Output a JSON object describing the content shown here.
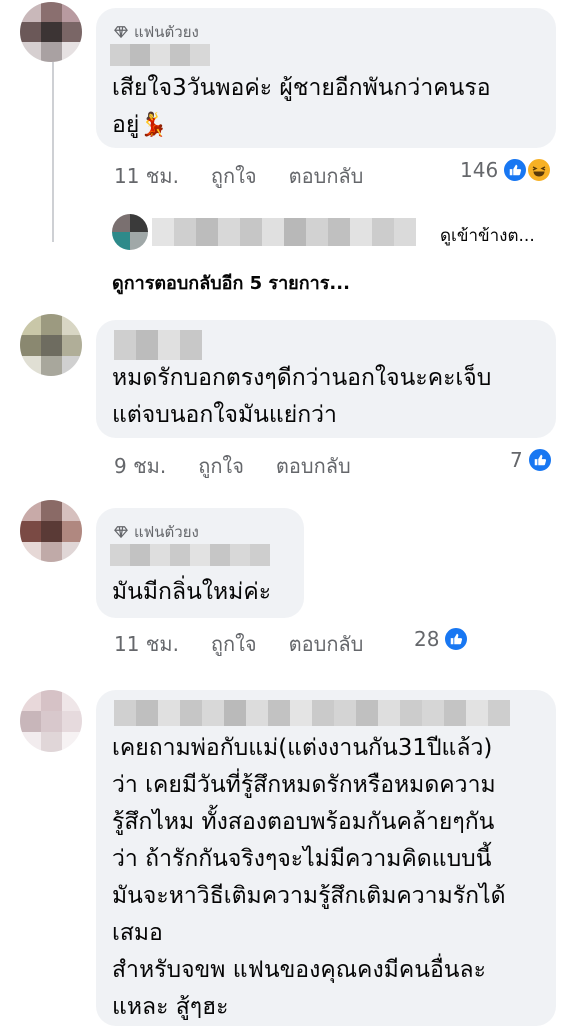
{
  "comments": [
    {
      "badge": "แฟนตัวยง",
      "text": "เสียใจ3วันพอค่ะ ผู้ชายอีกพันกว่าคนรอ\nอยู่💃",
      "time": "11 ชม.",
      "like_label": "ถูกใจ",
      "reply_label": "ตอบกลับ",
      "reaction_count": "146",
      "reactions": [
        "like-icon",
        "haha-icon"
      ]
    },
    {
      "badge": "",
      "text": "หมดรักบอกตรงๆดีกว่านอกใจนะคะเจ็บ\nแต่จบนอกใจมันแย่กว่า",
      "time": "9 ชม.",
      "like_label": "ถูกใจ",
      "reply_label": "ตอบกลับ",
      "reaction_count": "7",
      "reactions": [
        "like-icon"
      ]
    },
    {
      "badge": "แฟนตัวยง",
      "text": "มันมีกลิ่นใหม่ค่ะ",
      "time": "11 ชม.",
      "like_label": "ถูกใจ",
      "reply_label": "ตอบกลับ",
      "reaction_count": "28",
      "reactions": [
        "like-icon"
      ]
    },
    {
      "badge": "",
      "text": "เคยถามพ่อกับแม่(แต่งงานกัน31ปีแล้ว)\nว่า เคยมีวันที่รู้สึกหมดรักหรือหมดความ\nรู้สึกไหม ทั้งสองตอบพร้อมกันคล้ายๆกัน\nว่า ถ้ารักกันจริงๆจะไม่มีความคิดแบบนี้\nมันจะหาวิธีเติมความรู้สึกเติมความรักได้\nเสมอ\nสำหรับจขพ แฟนของคุณคงมีคนอื่นละ\nแหละ สู้ๆฮะ"
    }
  ],
  "reply_preview": {
    "text": "ดูเข้าข้างต..."
  },
  "more_replies": "ดูการตอบกลับอีก 5 รายการ...",
  "colors": {
    "bubble": "#f0f2f5",
    "like_blue": "#1877f2",
    "haha_yellow": "#f7b125",
    "meta_gray": "#65676b"
  }
}
